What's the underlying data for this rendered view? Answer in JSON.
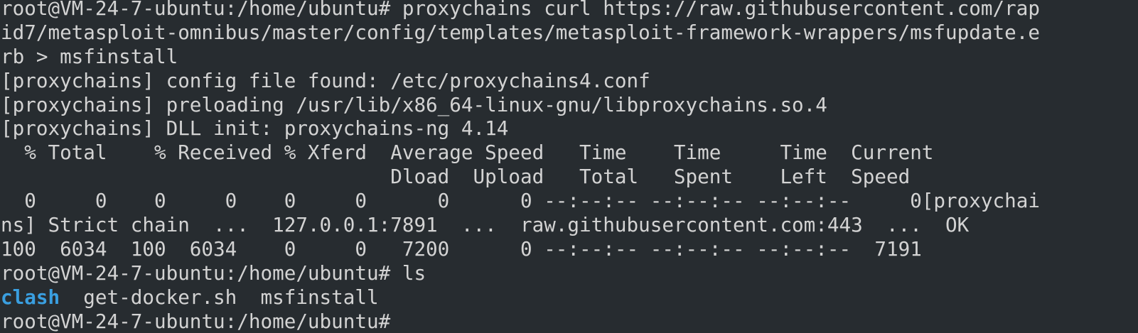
{
  "terminal": {
    "lines": [
      "root@VM-24-7-ubuntu:/home/ubuntu# proxychains curl https://raw.githubusercontent.com/rap",
      "id7/metasploit-omnibus/master/config/templates/metasploit-framework-wrappers/msfupdate.e",
      "rb > msfinstall",
      "[proxychains] config file found: /etc/proxychains4.conf",
      "[proxychains] preloading /usr/lib/x86_64-linux-gnu/libproxychains.so.4",
      "[proxychains] DLL init: proxychains-ng 4.14",
      "  % Total    % Received % Xferd  Average Speed   Time    Time     Time  Current",
      "                                 Dload  Upload   Total   Spent    Left  Speed",
      "  0     0    0     0    0     0      0      0 --:--:-- --:--:-- --:--:--     0[proxychai",
      "ns] Strict chain  ...  127.0.0.1:7891  ...  raw.githubusercontent.com:443  ...  OK",
      "100  6034  100  6034    0     0   7200      0 --:--:-- --:--:-- --:--:--  7191",
      "root@VM-24-7-ubuntu:/home/ubuntu# ls"
    ],
    "ls_output": {
      "dir": "clash",
      "files": "  get-docker.sh  msfinstall"
    },
    "next_prompt": "root@VM-24-7-ubuntu:/home/ubuntu#"
  },
  "colors": {
    "background": "#272c30",
    "text": "#d3d3d3",
    "directory": "#3a9fe0"
  }
}
